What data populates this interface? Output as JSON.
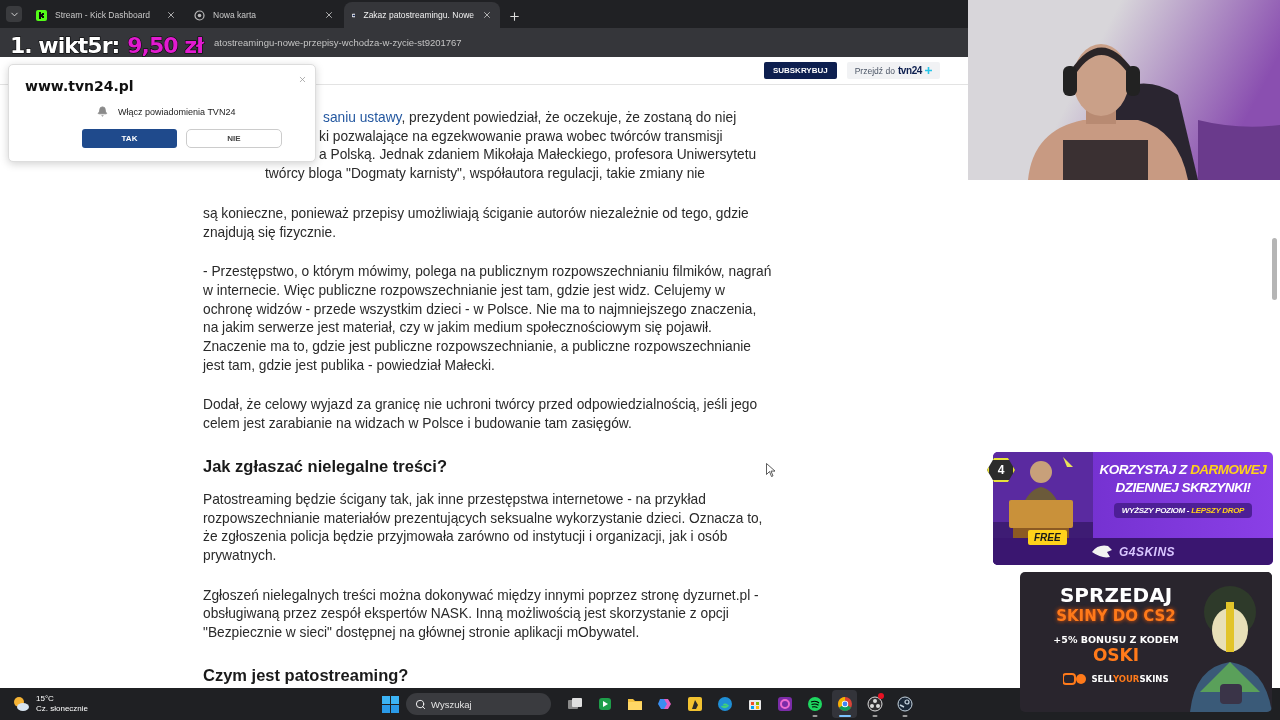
{
  "browser": {
    "tabs": [
      {
        "title": "Stream - Kick Dashboard",
        "selected": false
      },
      {
        "title": "Nowa karta",
        "selected": false
      },
      {
        "title": "Zakaz patostreamingu. Nowe",
        "selected": true
      }
    ],
    "url": "atostreamingu-nowe-przepisy-wchodza-w-zycie-st9201767"
  },
  "site_header": {
    "subscribe": "SUBSKRYBUJ",
    "goto": "Przejdź do",
    "brand": "tvn24"
  },
  "article": [
    {
      "kind": "partial",
      "lines": [
        {
          "link": "saniu ustawy",
          "text": ", prezydent powiedział, że oczekuje, że zostaną do niej"
        },
        {
          "text": "ki pozwalające na egzekwowanie prawa wobec twórców transmisji"
        },
        {
          "text": "a Polską. Jednak zdaniem Mikołaja Małeckiego, profesora Uniwersytetu"
        },
        {
          "text": "twórcy bloga \"Dogmaty karnisty\", współautora regulacji, takie zmiany nie"
        }
      ]
    },
    {
      "kind": "paragraph",
      "text": "są konieczne, ponieważ przepisy umożliwiają ściganie autorów niezależnie od tego, gdzie znajdują się fizycznie."
    },
    {
      "kind": "paragraph",
      "text": "- Przestępstwo, o którym mówimy, polega na publicznym rozpowszechnianiu filmików, nagrań w internecie. Więc publiczne rozpowszechnianie jest tam, gdzie jest widz. Celujemy w ochronę widzów - przede wszystkim dzieci - w Polsce. Nie ma to najmniejszego znaczenia, na jakim serwerze jest materiał, czy w jakim medium społecznościowym się pojawił. Znaczenie ma to, gdzie jest publiczne rozpowszechnianie, a publiczne rozpowszechnianie jest tam, gdzie jest publika - powiedział Małecki."
    },
    {
      "kind": "paragraph",
      "text": "Dodał, że celowy wyjazd za granicę nie uchroni twórcy przed odpowiedzialnością, jeśli jego celem jest zarabianie na widzach w Polsce i budowanie tam zasięgów."
    },
    {
      "kind": "heading",
      "text": "Jak zgłaszać nielegalne treści?"
    },
    {
      "kind": "paragraph",
      "text": "Patostreaming będzie ścigany tak, jak inne przestępstwa internetowe - na przykład rozpowszechnianie materiałów prezentujących seksualne wykorzystanie dzieci. Oznacza to, że zgłoszenia policja będzie przyjmowała zarówno od instytucji i organizacji, jak i osób prywatnych."
    },
    {
      "kind": "paragraph",
      "text": "Zgłoszeń nielegalnych treści można dokonywać między innymi poprzez stronę dyzurnet.pl - obsługiwaną przez zespół ekspertów NASK. Inną możliwością jest skorzystanie z opcji \"Bezpiecznie w sieci\" dostępnej na głównej stronie aplikacji mObywatel."
    },
    {
      "kind": "heading",
      "text": "Czym jest patostreaming?"
    }
  ],
  "notification_popup": {
    "site": "www.tvn24.pl",
    "message": "Włącz powiadomienia TVN24",
    "accept": "TAK",
    "decline": "NIE"
  },
  "donation": {
    "label": "1. wikt5r:",
    "amount": "9,50 zł"
  },
  "ad_top": {
    "level_badge": "4",
    "headline": [
      [
        {
          "text": "KORZYSTAJ Z ",
          "accent": false
        },
        {
          "text": "DARMOWEJ",
          "accent": true
        }
      ],
      [
        {
          "text": "DZIENNEJ SKRZYNKI!",
          "accent": false
        }
      ]
    ],
    "tagline": [
      {
        "text": "WYŻSZY POZIOM - ",
        "accent": false
      },
      {
        "text": "LEPSZY DROP",
        "accent": true
      }
    ],
    "free": "FREE",
    "logo": "G4SKINS"
  },
  "ad_bottom": {
    "title": "SPRZEDAJ",
    "subtitle": "SKINY DO CS2",
    "bonus": "+5% BONUSU Z KODEM",
    "code": "OSKI",
    "logo": [
      {
        "text": "SELL",
        "accent": false
      },
      {
        "text": "YOUR",
        "accent": true
      },
      {
        "text": "SKINS",
        "accent": false
      }
    ]
  },
  "taskbar": {
    "temperature": "15°C",
    "weather": "Cz. słonecznie",
    "search": {
      "placeholder": "Wyszukaj"
    },
    "apps": [
      {
        "running": false,
        "selected": false,
        "badge": false
      },
      {
        "running": false,
        "selected": false,
        "badge": false
      },
      {
        "running": false,
        "selected": false,
        "badge": false
      },
      {
        "running": false,
        "selected": false,
        "badge": false
      },
      {
        "running": false,
        "selected": false,
        "badge": false
      },
      {
        "running": false,
        "selected": false,
        "badge": false
      },
      {
        "running": false,
        "selected": false,
        "badge": false
      },
      {
        "running": false,
        "selected": false,
        "badge": false
      },
      {
        "running": true,
        "selected": false,
        "badge": false
      },
      {
        "running": true,
        "selected": true,
        "badge": false
      },
      {
        "running": true,
        "selected": false,
        "badge": true
      },
      {
        "running": true,
        "selected": false,
        "badge": false
      }
    ]
  }
}
